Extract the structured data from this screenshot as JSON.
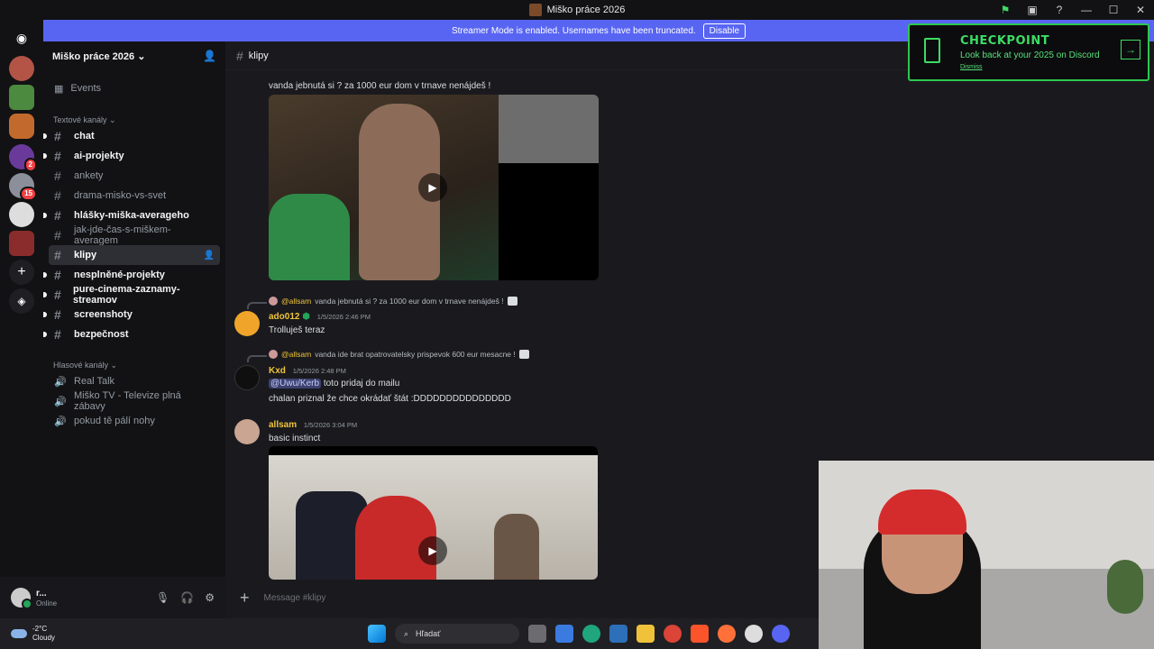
{
  "window": {
    "title": "Miško práce 2026",
    "controls": [
      "—",
      "☐",
      "✕"
    ]
  },
  "banner": {
    "text": "Streamer Mode is enabled. Usernames have been truncated.",
    "button": "Disable"
  },
  "servers": {
    "badges": [
      "2",
      "15"
    ]
  },
  "sidebar": {
    "guild_name": "Miško práce 2026",
    "events_label": "Events",
    "text_category": "Textové kanály",
    "text_channels": [
      {
        "name": "chat",
        "state": "unread"
      },
      {
        "name": "ai-projekty",
        "state": "unread"
      },
      {
        "name": "ankety",
        "state": "read"
      },
      {
        "name": "drama-misko-vs-svet",
        "state": "read"
      },
      {
        "name": "hlášky-miška-averageho",
        "state": "unread"
      },
      {
        "name": "jak-jde-čas-s-miškem-averagem",
        "state": "read"
      },
      {
        "name": "klipy",
        "state": "active"
      },
      {
        "name": "nesplněné-projekty",
        "state": "unread"
      },
      {
        "name": "pure-cinema-zaznamy-streamov",
        "state": "unread"
      },
      {
        "name": "screenshoty",
        "state": "unread"
      },
      {
        "name": "bezpečnost",
        "state": "unread"
      }
    ],
    "voice_category": "Hlasové kanály",
    "voice_channels": [
      "Real Talk",
      "Miško TV - Televize plná zábavy",
      "pokud tě pálí nohy"
    ]
  },
  "user": {
    "name": "r...",
    "status": "Online"
  },
  "channel_header": {
    "name": "klipy"
  },
  "messages": {
    "m0_text": "vanda jebnutá si ? za 1000 eur dom v trnave nenájdeš !",
    "m1": {
      "reply_author": "@allsam",
      "reply_text": "vanda jebnutá si ? za 1000 eur dom v trnave nenájdeš !",
      "author": "ado012",
      "timestamp": "1/5/2026 2:46 PM",
      "text": "Trolluješ teraz"
    },
    "m2": {
      "reply_author": "@allsam",
      "reply_text": "vanda ide brat opatrovatelsky prispevok 600 eur mesacne !",
      "author": "Kxd",
      "timestamp": "1/5/2026 2:48 PM",
      "mention": "@Uwu/Kerb",
      "text1": "toto pridaj do mailu",
      "text2": "chalan priznal že chce okrádať štát :DDDDDDDDDDDDDDD"
    },
    "m3": {
      "author": "allsam",
      "timestamp": "1/5/2026 3:04 PM",
      "text": "basic instinct"
    }
  },
  "composer": {
    "placeholder": "Message #klipy"
  },
  "checkpoint": {
    "title": "CHECKPOINT",
    "subtitle": "Look back at your 2025 on Discord",
    "dismiss": "Dismiss"
  },
  "taskbar": {
    "temp": "-2°C",
    "condition": "Cloudy",
    "search": "Hľadať"
  },
  "colors": {
    "accent": "#5865f2",
    "author": "#f0c43a",
    "checkpoint": "#3ddc64"
  }
}
